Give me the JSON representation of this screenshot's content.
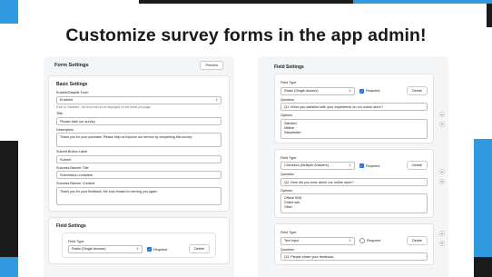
{
  "headline": "Customize survey forms in the app admin!",
  "left_panel": {
    "title": "Form Settings",
    "preview_label": "Preview",
    "basic": {
      "title": "Basic Settings",
      "enable_label": "Enable/Disable Form",
      "enable_value": "Enabled",
      "enable_help": "If set to 'Disabled', the form will not be displayed on the thank you page.",
      "title_label": "Title",
      "title_value": "Please take our survey",
      "description_label": "Description",
      "description_value": "Thank you for your purchase. Please help us improve our service by completing this survey.",
      "submit_label": "Submit Button Label",
      "submit_value": "Submit",
      "banner_title_label": "Success Banner Title",
      "banner_title_value": "Submission complete",
      "banner_content_label": "Success Banner Content",
      "banner_content_value": "Thank you for your feedback. We look forward to serving you again."
    },
    "field_settings": {
      "title": "Field Settings",
      "field_type_label": "Field Type",
      "field_type_value": "Radio (Single Answer)",
      "required_label": "Required",
      "delete_label": "Delete"
    }
  },
  "right_panel": {
    "title": "Field Settings",
    "fields": [
      {
        "type_label": "Field Type",
        "type_value": "Radio (Single Answer)",
        "required": true,
        "required_label": "Required",
        "delete_label": "Delete",
        "question_label": "Question",
        "question_value": "Q1. Were you satisfied with your experience on our online store?",
        "options_label": "Options",
        "options_value": "Satisfied\nNeither\nDissatisfied"
      },
      {
        "type_label": "Field Type",
        "type_value": "Checkbox (Multiple Answers)",
        "required": true,
        "required_label": "Required",
        "delete_label": "Delete",
        "question_label": "Question",
        "question_value": "Q2. How did you hear about our online store?",
        "options_label": "Options",
        "options_value": "Official SNS\nOnline ads\nOther"
      },
      {
        "type_label": "Field Type",
        "type_value": "Text input",
        "required": false,
        "required_label": "Required",
        "delete_label": "Delete",
        "question_label": "Question",
        "question_value": "Q3. Please share your feedback."
      }
    ]
  },
  "colors": {
    "accent_blue": "#2f9ae0",
    "dark": "#1b1b1b",
    "checkbox_blue": "#2c6ecb"
  }
}
